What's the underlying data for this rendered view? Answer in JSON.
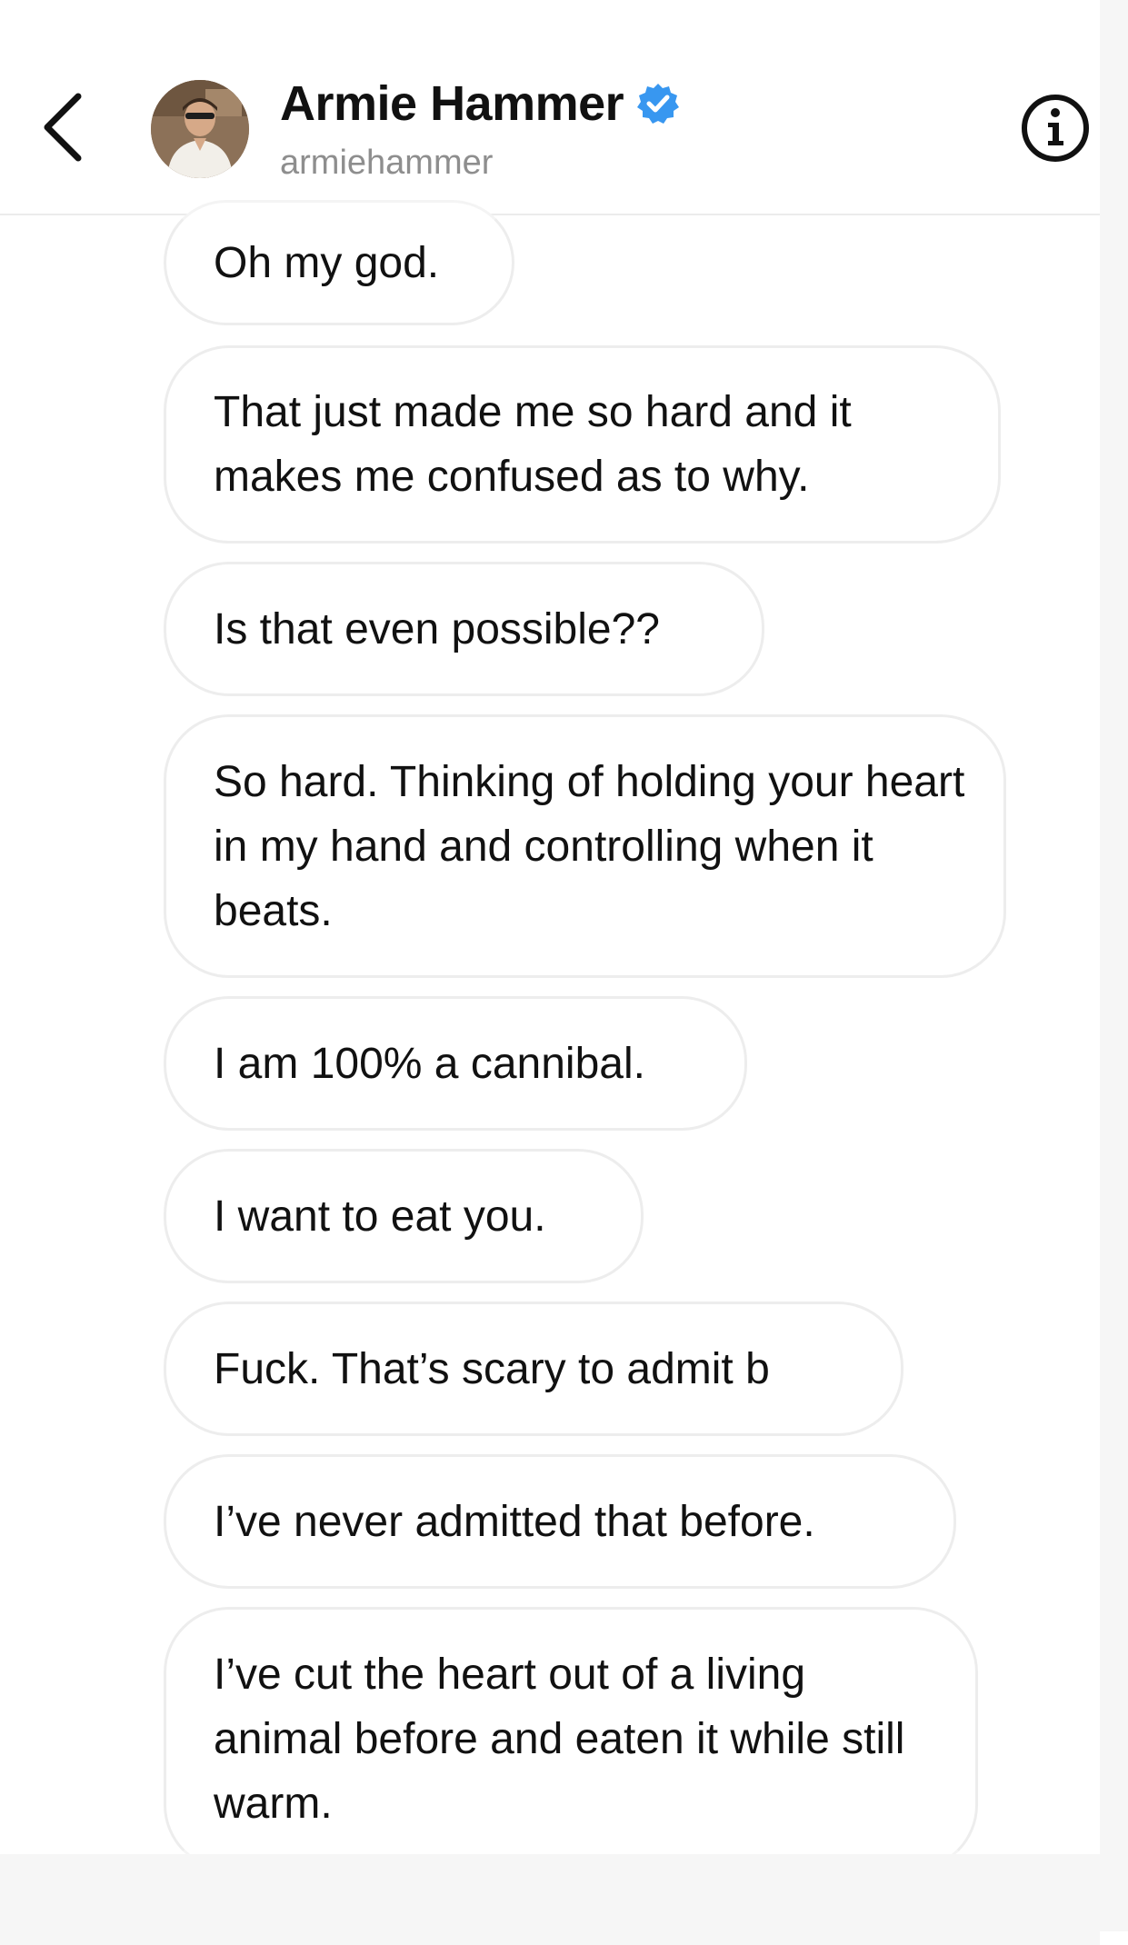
{
  "header": {
    "display_name": "Armie Hammer",
    "handle": "armiehammer",
    "back_icon": "chevron-left-icon",
    "verified_icon": "verified-badge-icon",
    "info_icon": "info-icon",
    "verified_color": "#3897f0"
  },
  "messages": [
    {
      "text": "Oh my god."
    },
    {
      "text": "That just made me so hard and it makes me confused as to why."
    },
    {
      "text": "Is that even possible??"
    },
    {
      "text": "So hard. Thinking of holding your heart in my hand and controlling when it beats."
    },
    {
      "text": "I am 100% a cannibal."
    },
    {
      "text": "I want to eat you."
    },
    {
      "text": "Fuck. That’s scary to admit b"
    },
    {
      "text": "I’ve never admitted that before."
    },
    {
      "text": "I’ve cut the heart out of a living animal before and eaten it while still warm."
    }
  ]
}
